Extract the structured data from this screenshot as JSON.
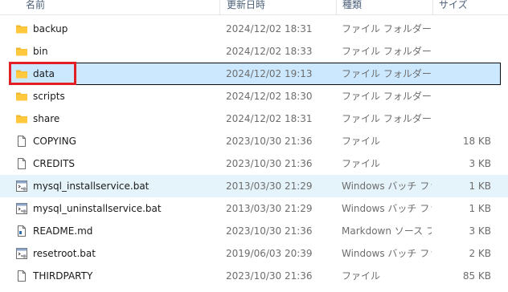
{
  "columns": {
    "name": "名前",
    "date": "更新日時",
    "type": "種類",
    "size": "サイズ"
  },
  "rows": [
    {
      "name": "backup",
      "date": "2024/12/02 18:31",
      "type": "ファイル フォルダー",
      "size": "",
      "icon": "folder-icon"
    },
    {
      "name": "bin",
      "date": "2024/12/02 18:33",
      "type": "ファイル フォルダー",
      "size": "",
      "icon": "folder-icon"
    },
    {
      "name": "data",
      "date": "2024/12/02 19:13",
      "type": "ファイル フォルダー",
      "size": "",
      "icon": "folder-icon"
    },
    {
      "name": "scripts",
      "date": "2024/12/02 18:30",
      "type": "ファイル フォルダー",
      "size": "",
      "icon": "folder-icon"
    },
    {
      "name": "share",
      "date": "2024/12/02 18:31",
      "type": "ファイル フォルダー",
      "size": "",
      "icon": "folder-icon"
    },
    {
      "name": "COPYING",
      "date": "2023/10/30 21:36",
      "type": "ファイル",
      "size": "18 KB",
      "icon": "file-icon"
    },
    {
      "name": "CREDITS",
      "date": "2023/10/30 21:36",
      "type": "ファイル",
      "size": "3 KB",
      "icon": "file-icon"
    },
    {
      "name": "mysql_installservice.bat",
      "date": "2013/03/30 21:29",
      "type": "Windows バッチ ファ...",
      "size": "1 KB",
      "icon": "batch-file-icon"
    },
    {
      "name": "mysql_uninstallservice.bat",
      "date": "2013/03/30 21:29",
      "type": "Windows バッチ ファ...",
      "size": "1 KB",
      "icon": "batch-file-icon"
    },
    {
      "name": "README.md",
      "date": "2023/10/30 21:36",
      "type": "Markdown ソース ファ...",
      "size": "3 KB",
      "icon": "markdown-file-icon"
    },
    {
      "name": "resetroot.bat",
      "date": "2019/06/03 20:39",
      "type": "Windows バッチ ファ...",
      "size": "2 KB",
      "icon": "batch-file-icon"
    },
    {
      "name": "THIRDPARTY",
      "date": "2023/10/30 21:36",
      "type": "ファイル",
      "size": "85 KB",
      "icon": "file-icon"
    }
  ],
  "selected_row": "data",
  "hover_row": "mysql_installservice.bat",
  "colors": {
    "selection": "#cce8ff",
    "hover": "#e5f3fb",
    "annotation": "#e31e24",
    "folder": "#ffc83d"
  }
}
